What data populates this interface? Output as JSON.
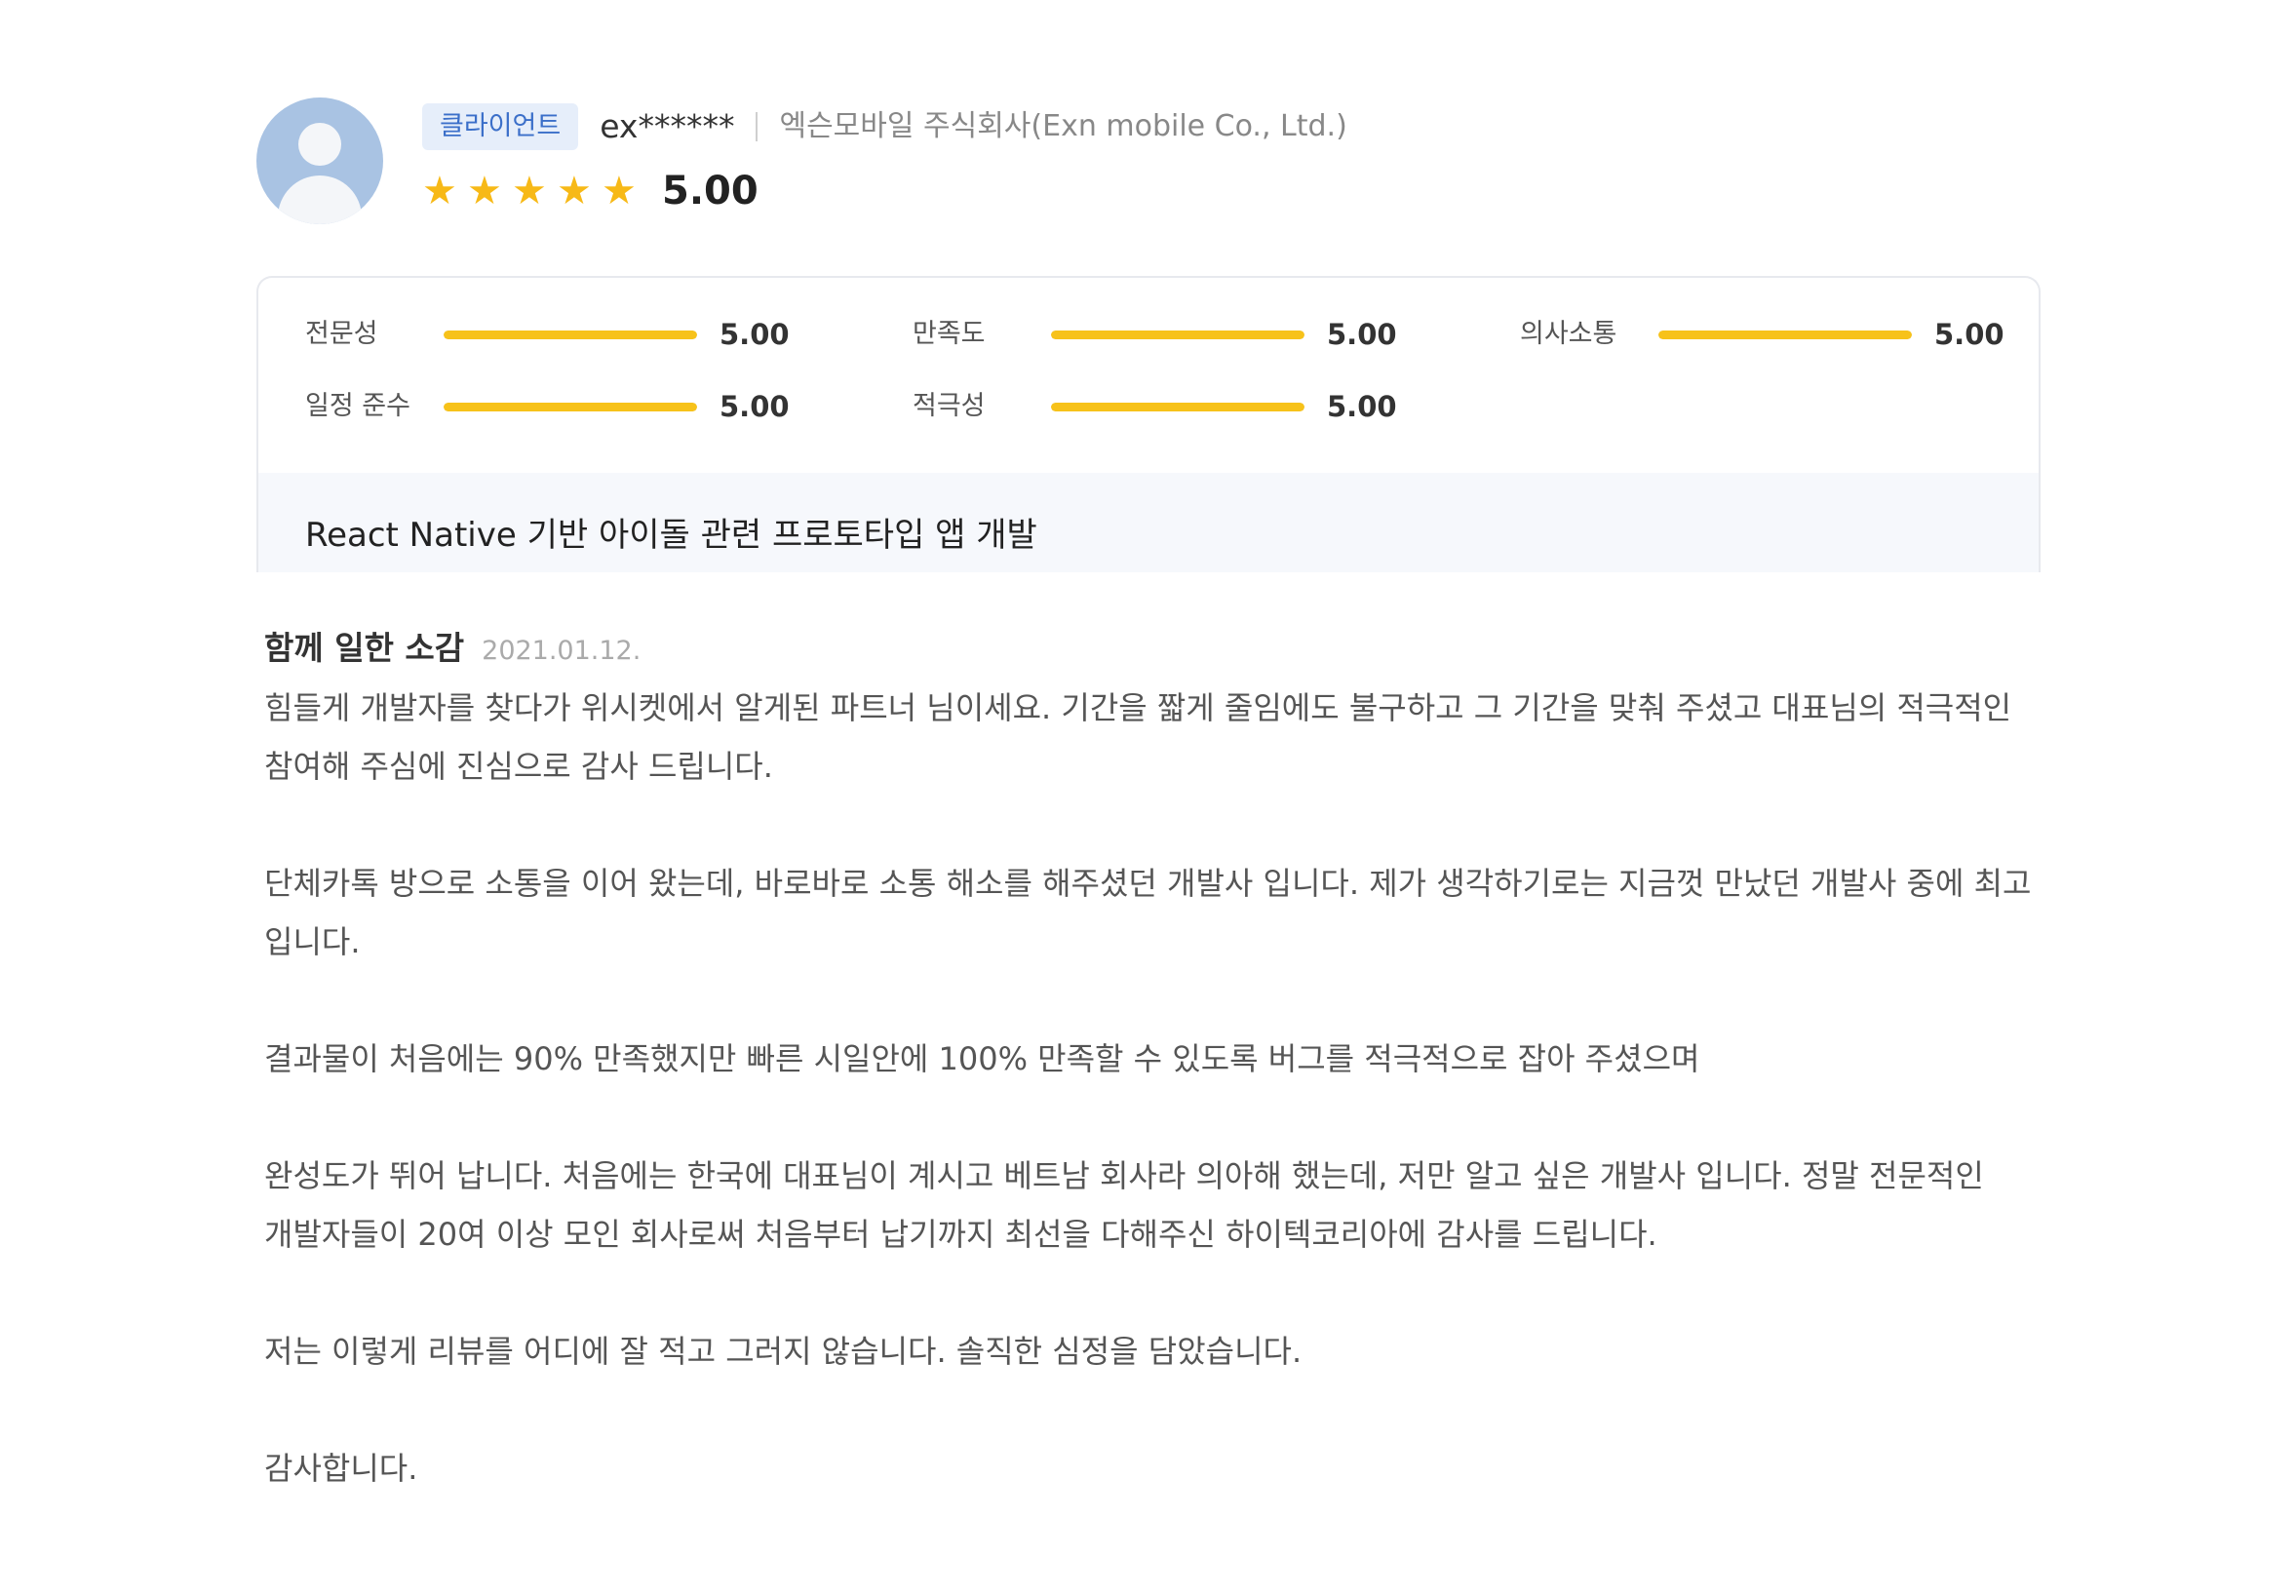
{
  "reviewer": {
    "badge": "클라이언트",
    "username": "ex******",
    "company": "엑슨모바일 주식회사(Exn mobile Co., Ltd.)",
    "rating": "5.00",
    "stars": 5,
    "star_color": "#f7b917"
  },
  "metrics": [
    {
      "label": "전문성",
      "value": "5.00",
      "fill": 1.0
    },
    {
      "label": "만족도",
      "value": "5.00",
      "fill": 1.0
    },
    {
      "label": "의사소통",
      "value": "5.00",
      "fill": 1.0
    },
    {
      "label": "일정 준수",
      "value": "5.00",
      "fill": 1.0
    },
    {
      "label": "적극성",
      "value": "5.00",
      "fill": 1.0
    }
  ],
  "project": {
    "title": "React Native 기반 아이돌 관련 프로토타입 앱 개발"
  },
  "review": {
    "heading": "함께 일한 소감",
    "date": "2021.01.12.",
    "paragraphs": [
      "힘들게 개발자를 찾다가 위시켓에서 알게된 파트너 님이세요. 기간을 짧게 줄임에도 불구하고 그 기간을 맞춰 주셨고 대표님의 적극적인 참여해 주심에 진심으로 감사 드립니다.",
      "단체카톡 방으로 소통을 이어 왔는데, 바로바로 소통 해소를 해주셨던 개발사 입니다. 제가 생각하기로는 지금껏 만났던 개발사 중에 최고 입니다.",
      "결과물이 처음에는 90% 만족했지만 빠른 시일안에 100% 만족할 수 있도록 버그를 적극적으로 잡아 주셨으며",
      "완성도가 뛰어 납니다. 처음에는 한국에 대표님이 계시고 베트남 회사라 의아해 했는데, 저만 알고 싶은 개발사 입니다. 정말 전문적인 개발자들이 20여 이상 모인 회사로써 처음부터 납기까지 최선을 다해주신 하이텍코리아에 감사를 드립니다.",
      "저는 이렇게 리뷰를 어디에 잘 적고 그러지 않습니다. 솔직한 심정을 담았습니다.",
      "감사합니다."
    ]
  }
}
